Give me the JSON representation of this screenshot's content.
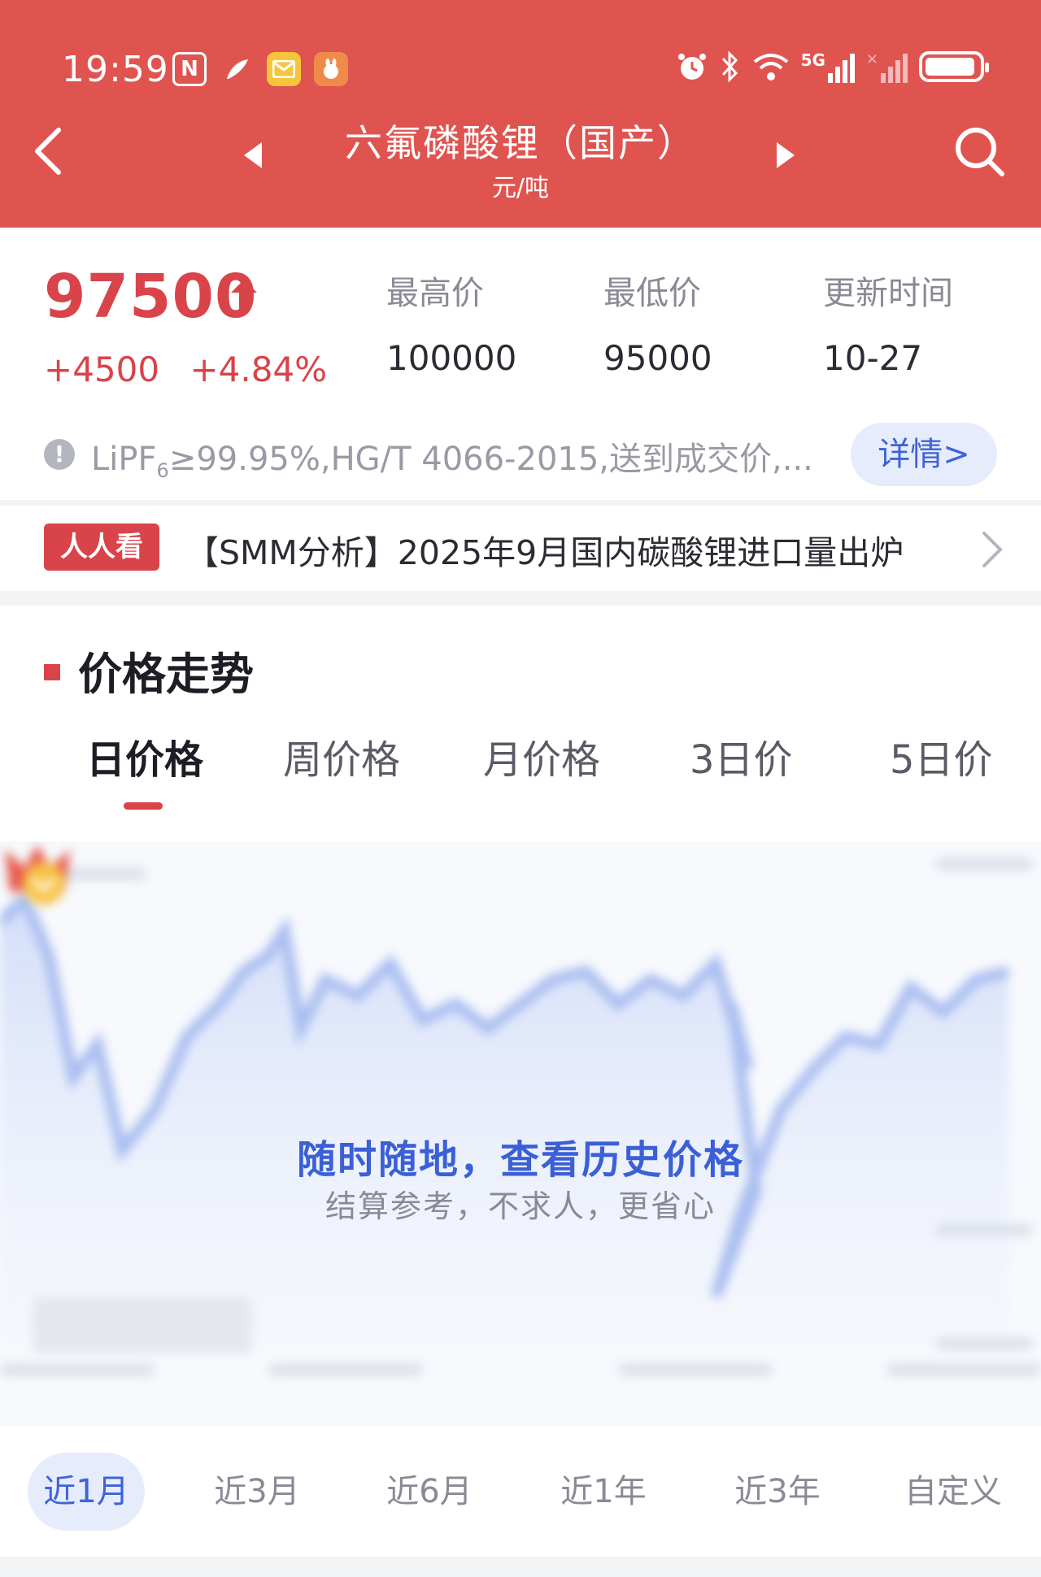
{
  "status_bar": {
    "time": "19:59",
    "app_icons": [
      "nfc-icon",
      "feather-icon",
      "mail-icon",
      "bunny-app-icon"
    ],
    "right_icons": [
      "alarm-icon",
      "bluetooth-icon",
      "wifi-icon",
      "5g-signal-icon",
      "no-signal-icon",
      "battery-icon"
    ],
    "network": "5G"
  },
  "nav": {
    "title": "六氟磷酸锂（国产）",
    "unit": "元/吨"
  },
  "price_card": {
    "price": "97500",
    "change_abs": "+4500",
    "change_pct": "+4.84%",
    "stats": [
      {
        "label": "最高价",
        "value": "100000"
      },
      {
        "label": "最低价",
        "value": "95000"
      },
      {
        "label": "更新时间",
        "value": "10-27"
      }
    ],
    "spec_prefix": "LiPF",
    "spec_sub": "6",
    "spec_rest": "≥99.95%,HG/T 4066-2015,送到成交价,...",
    "detail_label": "详情>"
  },
  "news": {
    "badge": "人人看",
    "text": "【SMM分析】2025年9月国内碳酸锂进口量出炉"
  },
  "trend": {
    "section_title": "价格走势",
    "tabs": [
      "日价格",
      "周价格",
      "月价格",
      "3日价",
      "5日价"
    ],
    "active_tab": 0,
    "promo_title": "随时随地，查看历史价格",
    "promo_subtitle": "结算参考，不求人，更省心",
    "ranges": [
      "近1月",
      "近3月",
      "近6月",
      "近1年",
      "近3年",
      "自定义"
    ],
    "active_range": 0
  },
  "colors": {
    "header_red": "#e05450",
    "price_red": "#d9434a",
    "link_blue": "#3d63d9",
    "chip_blue_bg": "#e6ecfb"
  }
}
